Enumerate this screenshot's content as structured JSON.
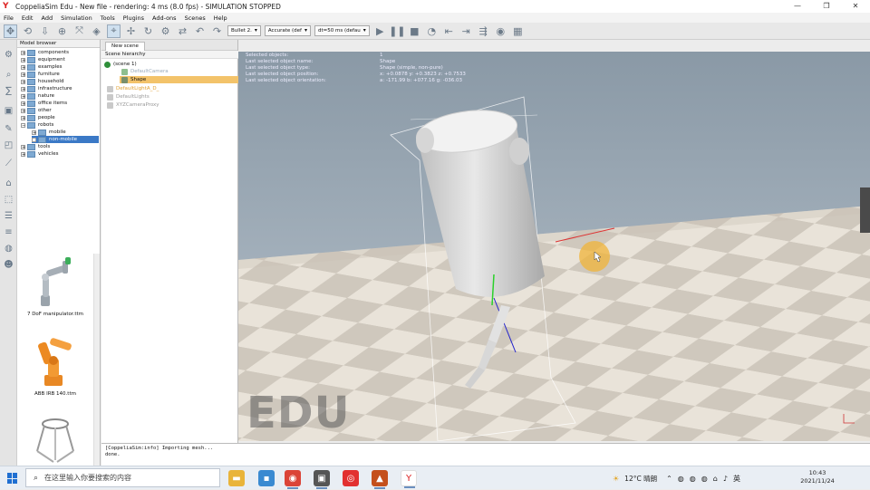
{
  "window": {
    "title": "CoppeliaSim Edu - New file - rendering: 4 ms (8.0 fps) - SIMULATION STOPPED",
    "controls": [
      "—",
      "❐",
      "✕"
    ]
  },
  "menu": [
    "File",
    "Edit",
    "Add",
    "Simulation",
    "Tools",
    "Plugins",
    "Add-ons",
    "Scenes",
    "Help"
  ],
  "toolbar": {
    "engine": "Bullet 2.",
    "accuracy": "Accurate (def",
    "timestep": "dt=50 ms (defau"
  },
  "model_browser": {
    "header": "Model browser",
    "items": [
      {
        "label": "components",
        "indent": 0
      },
      {
        "label": "equipment",
        "indent": 0
      },
      {
        "label": "examples",
        "indent": 0
      },
      {
        "label": "furniture",
        "indent": 0
      },
      {
        "label": "household",
        "indent": 0
      },
      {
        "label": "infrastructure",
        "indent": 0
      },
      {
        "label": "nature",
        "indent": 0
      },
      {
        "label": "office items",
        "indent": 0
      },
      {
        "label": "other",
        "indent": 0
      },
      {
        "label": "people",
        "indent": 0
      },
      {
        "label": "robots",
        "indent": 0
      },
      {
        "label": "mobile",
        "indent": 1
      },
      {
        "label": "non-mobile",
        "indent": 1
      },
      {
        "label": "tools",
        "indent": 0
      },
      {
        "label": "vehicles",
        "indent": 0
      }
    ],
    "thumbnails": [
      "7 DoF manipulator.ttm",
      "ABB IRB 140.ttm",
      ""
    ]
  },
  "scene": {
    "tab": "New scene",
    "header": "Scene hierarchy",
    "items": [
      {
        "label": "(scene 1)",
        "indent": 0,
        "color": "#2f8f3a"
      },
      {
        "label": "DefaultCamera",
        "indent": 1,
        "color": "#8fbf8f"
      },
      {
        "label": "Shape",
        "indent": 1,
        "color": "#f0c850"
      },
      {
        "label": "DefaultLightA_D_",
        "indent": 1,
        "color": "#e0a030"
      },
      {
        "label": "DefaultLights",
        "indent": 1,
        "color": "#bbbbbb"
      },
      {
        "label": "XYZCameraProxy",
        "indent": 1,
        "color": "#bbbbbb"
      }
    ]
  },
  "info": {
    "rows": [
      {
        "k": "Selected objects:",
        "v": "1"
      },
      {
        "k": "Last selected object name:",
        "v": "Shape"
      },
      {
        "k": "Last selected object type:",
        "v": "Shape (simple, non-pure)"
      },
      {
        "k": "Last selected object position:",
        "v": "x: +0.0878   y: +0.3823   z: +0.7533"
      },
      {
        "k": "Last selected object orientation:",
        "v": "a: -171.99   b: +077.16   g: -036.03"
      }
    ]
  },
  "watermark": "EDU",
  "console": {
    "line1": "[CoppeliaSim:info]      Importing mesh...",
    "line2": "done."
  },
  "taskbar": {
    "search_placeholder": "在这里输入你要搜索的内容",
    "weather": "12°C 晴朗",
    "ime": "英",
    "time": "10:43",
    "date": "2021/11/24"
  }
}
